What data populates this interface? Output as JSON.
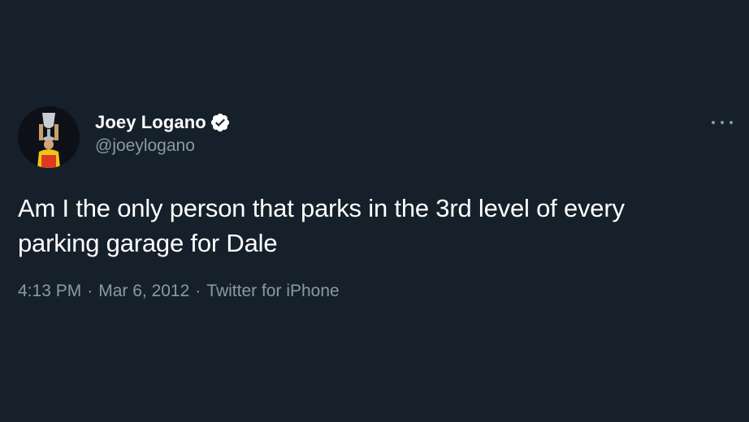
{
  "tweet": {
    "author": {
      "display_name": "Joey Logano",
      "handle": "@joeylogano",
      "verified": true
    },
    "text_lines": [
      "Am I the only person that parks in the 3rd level of every",
      "parking garage for Dale"
    ],
    "time": "4:13 PM",
    "date": "Mar 6, 2012",
    "source": "Twitter for iPhone",
    "separator": "·"
  },
  "icons": {
    "verified": "verified-badge-icon",
    "more": "more-horizontal-icon"
  },
  "colors": {
    "background": "#15202b",
    "primary_text": "#ffffff",
    "secondary_text": "#8b98a5"
  }
}
